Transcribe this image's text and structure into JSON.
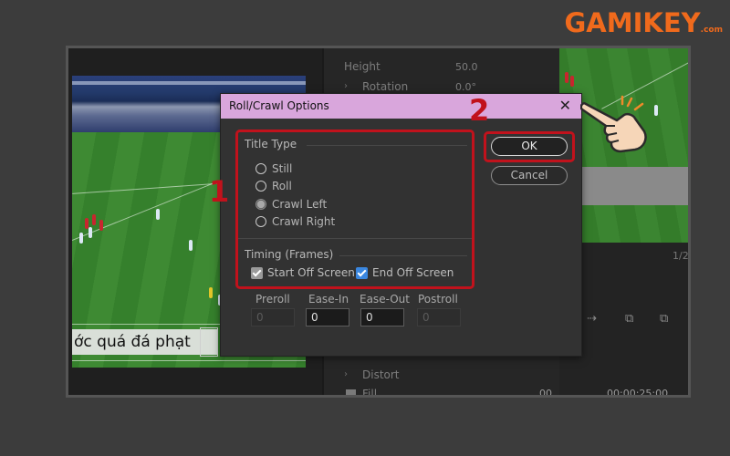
{
  "logo": {
    "brand": "GAMIKEY",
    "suffix": ".com"
  },
  "effect_controls": {
    "rows": [
      {
        "label": "Height",
        "value": "50.0"
      },
      {
        "label": "Rotation",
        "value": "0.0°"
      },
      {
        "label": "Distort",
        "value": ""
      },
      {
        "label": "Fill",
        "value": ""
      }
    ],
    "timecode_left": "00",
    "timecode_right": "00:00:25:00"
  },
  "preview": {
    "caption_text": "ớc quá đá phạt",
    "zoom_label": "1/2"
  },
  "dialog": {
    "title": "Roll/Crawl Options",
    "close_glyph": "✕",
    "title_type": {
      "label": "Title Type",
      "options": [
        {
          "label": "Still",
          "selected": false
        },
        {
          "label": "Roll",
          "selected": false
        },
        {
          "label": "Crawl Left",
          "selected": true
        },
        {
          "label": "Crawl Right",
          "selected": false
        }
      ]
    },
    "timing": {
      "label": "Timing (Frames)",
      "start_off_screen": {
        "label": "Start Off Screen",
        "checked": true
      },
      "end_off_screen": {
        "label": "End Off Screen",
        "checked": true
      },
      "fields": [
        {
          "label": "Preroll",
          "value": "0",
          "enabled": false
        },
        {
          "label": "Ease-In",
          "value": "0",
          "enabled": true
        },
        {
          "label": "Ease-Out",
          "value": "0",
          "enabled": true
        },
        {
          "label": "Postroll",
          "value": "0",
          "enabled": false
        }
      ]
    },
    "ok_label": "OK",
    "cancel_label": "Cancel"
  },
  "annotations": {
    "step1": "1",
    "step2": "2"
  },
  "colors": {
    "highlight": "#c1121c",
    "title_bar": "#d9a6dc",
    "brand": "#f06a1c",
    "checkbox_blue": "#3a87e0"
  }
}
